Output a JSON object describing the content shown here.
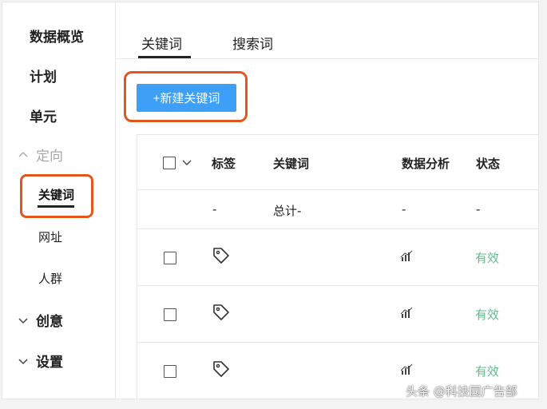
{
  "sidebar": {
    "overview": "数据概览",
    "plan": "计划",
    "unit": "单元",
    "targeting": "定向",
    "keywords": "关键词",
    "url": "网址",
    "audience": "人群",
    "creative": "创意",
    "settings": "设置"
  },
  "tabs": {
    "keywords": "关键词",
    "search_terms": "搜索词"
  },
  "toolbar": {
    "new_keyword": "+新建关键词"
  },
  "table": {
    "headers": {
      "tag": "标签",
      "keyword": "关键词",
      "analytics": "数据分析",
      "status": "状态"
    },
    "total_row": {
      "tag": "-",
      "keyword": "总计-",
      "analytics": "-",
      "status": "-"
    },
    "rows": [
      {
        "status": "有效"
      },
      {
        "status": "有效"
      },
      {
        "status": "有效"
      }
    ]
  },
  "colors": {
    "accent": "#3d9ff5",
    "highlight_border": "#e2571d",
    "status_valid": "#5cbf8a"
  },
  "icons": [
    "chevron-up-icon",
    "chevron-down-icon",
    "tag-icon",
    "bar-chart-icon"
  ],
  "watermark": "头条 @科技园广告部"
}
